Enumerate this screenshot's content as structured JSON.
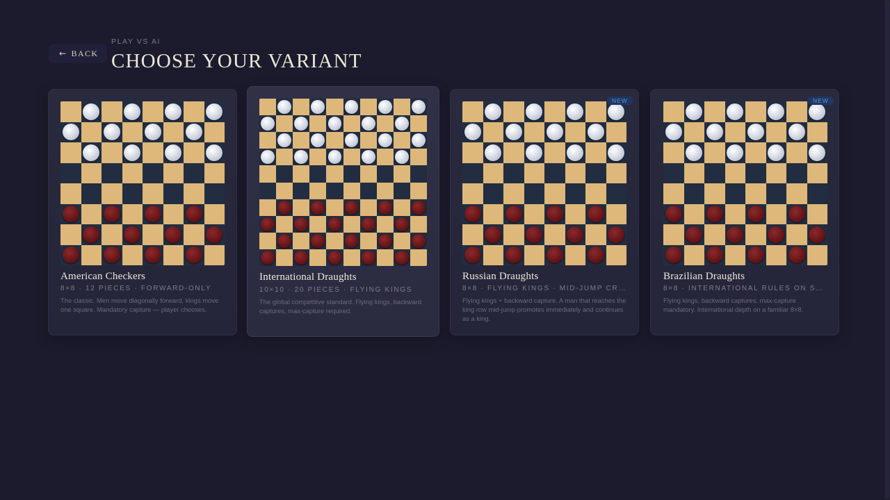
{
  "header": {
    "back_label": "BACK",
    "eyebrow": "PLAY VS AI",
    "title": "CHOOSE YOUR VARIANT"
  },
  "colors": {
    "background": "#1b1b2d",
    "light_square": "#ddb87a",
    "dark_square": "#222d41",
    "white_piece": "#e6e9ef",
    "red_piece": "#6a1619",
    "badge_text": "#5f8fd6"
  },
  "variants": [
    {
      "title": "American Checkers",
      "meta": "8×8 · 12 PIECES · FORWARD-ONLY",
      "description": "The classic. Men move diagonally forward, kings move one square. Mandatory capture — player chooses.",
      "badge": "",
      "board_size": 8,
      "piece_rows": 3
    },
    {
      "title": "International Draughts",
      "meta": "10×10 · 20 PIECES · FLYING KINGS",
      "description": "The global competitive standard. Flying kings, backward captures, max-capture required.",
      "badge": "",
      "board_size": 10,
      "piece_rows": 4
    },
    {
      "title": "Russian Draughts",
      "meta": "8×8 · FLYING KINGS · MID-JUMP CRO…",
      "description": "Flying kings + backward capture. A man that reaches the king row mid-jump promotes immediately and continues as a king.",
      "badge": "NEW",
      "board_size": 8,
      "piece_rows": 3
    },
    {
      "title": "Brazilian Draughts",
      "meta": "8×8 · INTERNATIONAL RULES ON SM…",
      "description": "Flying kings, backward captures, max-capture mandatory. International depth on a familiar 8×8.",
      "badge": "NEW",
      "board_size": 8,
      "piece_rows": 3
    }
  ]
}
